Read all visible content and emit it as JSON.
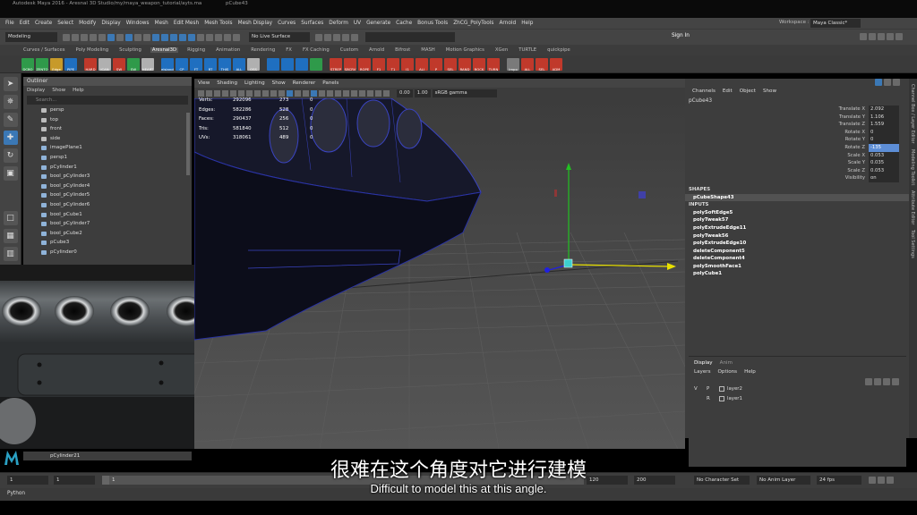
{
  "window": {
    "title": "Autodesk Maya 2016 - Aresnal 3D Studio/my/maya_weapon_tutorial/ayts.ma",
    "title_right": "pCube43"
  },
  "menu": [
    "File",
    "Edit",
    "Create",
    "Select",
    "Modify",
    "Display",
    "Windows",
    "Mesh",
    "Edit Mesh",
    "Mesh Tools",
    "Mesh Display",
    "Curves",
    "Surfaces",
    "Deform",
    "UV",
    "Generate",
    "Cache",
    "Bonus Tools",
    "ZhCG_PolyTools",
    "Arnold",
    "Help"
  ],
  "workspace": {
    "label": "Workspace :",
    "value": "Maya Classic*"
  },
  "status": {
    "mode": "Modeling",
    "live_surface": "No Live Surface",
    "sign_in": "Sign In"
  },
  "shelf_tabs": [
    "Curves / Surfaces",
    "Poly Modeling",
    "Sculpting",
    "Aresnal3D",
    "Rigging",
    "Animation",
    "Rendering",
    "FX",
    "FX Caching",
    "Custom",
    "Arnold",
    "Bifrost",
    "MASH",
    "Motion Graphics",
    "XGen",
    "TURTLE",
    "quickpipe"
  ],
  "shelf_active": "Aresnal3D",
  "shelf_icons": [
    {
      "label": "DCBO",
      "color": "#2f9a4a"
    },
    {
      "label": "ZENTO",
      "color": "#2f9a4a"
    },
    {
      "label": "Edge",
      "color": "#c79a2a"
    },
    {
      "label": "PIPE",
      "color": "#1f6fc0"
    },
    {
      "label": "HARD",
      "color": "#c0392b"
    },
    {
      "label": "ICAN",
      "color": "#b0b0b0"
    },
    {
      "label": "SW",
      "color": "#c0392b"
    },
    {
      "label": "SW",
      "color": "#2f9a4a"
    },
    {
      "label": "HEART",
      "color": "#b0b0b0"
    },
    {
      "label": "eIslands",
      "color": "#1f6fc0"
    },
    {
      "label": "CP",
      "color": "#1f6fc0"
    },
    {
      "label": "FT",
      "color": "#1f6fc0"
    },
    {
      "label": "RT",
      "color": "#1f6fc0"
    },
    {
      "label": "THIS",
      "color": "#1f6fc0"
    },
    {
      "label": "ALL",
      "color": "#1f6fc0"
    },
    {
      "label": "OSS",
      "color": "#b0b0b0"
    },
    {
      "label": "",
      "color": "#1f6fc0"
    },
    {
      "label": "",
      "color": "#1f6fc0"
    },
    {
      "label": "",
      "color": "#1f6fc0"
    },
    {
      "label": "",
      "color": "#2f9a4a"
    },
    {
      "label": "STREP",
      "color": "#c0392b"
    },
    {
      "label": "SBCRV",
      "color": "#c0392b"
    },
    {
      "label": "ROPE",
      "color": "#c0392b"
    },
    {
      "label": "F1",
      "color": "#c0392b"
    },
    {
      "label": "T1",
      "color": "#c0392b"
    },
    {
      "label": "I1",
      "color": "#c0392b"
    },
    {
      "label": "ALI",
      "color": "#c0392b"
    },
    {
      "label": "P",
      "color": "#c0392b"
    },
    {
      "label": "SEL",
      "color": "#c0392b"
    },
    {
      "label": "RAND",
      "color": "#c0392b"
    },
    {
      "label": "ROCK",
      "color": "#c0392b"
    },
    {
      "label": "TURN",
      "color": "#c0392b"
    },
    {
      "label": "Impo",
      "color": "#7a7a7a"
    },
    {
      "label": "ALL",
      "color": "#c0392b"
    },
    {
      "label": "SEL",
      "color": "#c0392b"
    },
    {
      "label": "ADM",
      "color": "#c0392b"
    }
  ],
  "outliner": {
    "title": "Outliner",
    "menus": [
      "Display",
      "Show",
      "Help"
    ],
    "search_placeholder": "Search...",
    "items": [
      "persp",
      "top",
      "front",
      "side",
      "imagePlane1",
      "persp1",
      "pCylinder1",
      "bool_pCylinder3",
      "bool_pCylinder4",
      "bool_pCylinder5",
      "bool_pCylinder6",
      "bool_pCube1",
      "bool_pCylinder7",
      "bool_pCube2",
      "pCube3",
      "pCylinder0"
    ],
    "last_item": "pCylinder21"
  },
  "viewport": {
    "menus": [
      "View",
      "Shading",
      "Lighting",
      "Show",
      "Renderer",
      "Panels"
    ],
    "exposure": "0.00",
    "gamma_value": "1.00",
    "color_space": "sRGB gamma",
    "hud": [
      {
        "k": "Verts:",
        "v1": "292096",
        "v2": "273",
        "v3": "0"
      },
      {
        "k": "Edges:",
        "v1": "582286",
        "v2": "528",
        "v3": "0"
      },
      {
        "k": "Faces:",
        "v1": "290437",
        "v2": "256",
        "v3": "0"
      },
      {
        "k": "Tris:",
        "v1": "581840",
        "v2": "512",
        "v3": "0"
      },
      {
        "k": "UVs:",
        "v1": "318061",
        "v2": "489",
        "v3": "0"
      }
    ]
  },
  "channelbox": {
    "menus": [
      "Channels",
      "Edit",
      "Object",
      "Show"
    ],
    "object": "pCube43",
    "channels": [
      {
        "label": "Translate X",
        "value": "2.092"
      },
      {
        "label": "Translate Y",
        "value": "1.106"
      },
      {
        "label": "Translate Z",
        "value": "1.559"
      },
      {
        "label": "Rotate X",
        "value": "0"
      },
      {
        "label": "Rotate Y",
        "value": "0"
      },
      {
        "label": "Rotate Z",
        "value": "-135"
      },
      {
        "label": "Scale X",
        "value": "0.053"
      },
      {
        "label": "Scale Y",
        "value": "0.035"
      },
      {
        "label": "Scale Z",
        "value": "0.053"
      },
      {
        "label": "Visibility",
        "value": "on"
      }
    ],
    "selected_channel": "Rotate Z",
    "shapes_title": "SHAPES",
    "shape": "pCubeShape43",
    "inputs_title": "INPUTS",
    "inputs": [
      "polySoftEdge5",
      "polyTweak57",
      "polyExtrudeEdge11",
      "polyTweak56",
      "polyExtrudeEdge10",
      "deleteComponent5",
      "deleteComponent4",
      "polySmoothFace1",
      "polyCube1"
    ]
  },
  "sidetabs": [
    "Channel Box / Layer Editor",
    "Modeling Toolkit",
    "Attribute Editor",
    "Tool Settings"
  ],
  "layers": {
    "tabs": [
      "Display",
      "Anim"
    ],
    "menus": [
      "Layers",
      "Options",
      "Help"
    ],
    "rows": [
      {
        "v": "V",
        "p": "P",
        "name": "layer2"
      },
      {
        "v": "",
        "p": "R",
        "name": "layer1"
      }
    ]
  },
  "timeline": {
    "start": "1",
    "start2": "1",
    "current": "1",
    "end": "120",
    "end2": "200",
    "character_set": "No Character Set",
    "anim_layer": "No Anim Layer",
    "fps": "24 fps"
  },
  "cmd": {
    "lang": "Python"
  },
  "subtitles": {
    "cn": "很难在这个角度对它进行建模",
    "en": "Difficult to model this at this angle."
  },
  "colors": {
    "accent": "#3b78b5",
    "selection": "#5d8ed6",
    "bg": "#444444"
  }
}
